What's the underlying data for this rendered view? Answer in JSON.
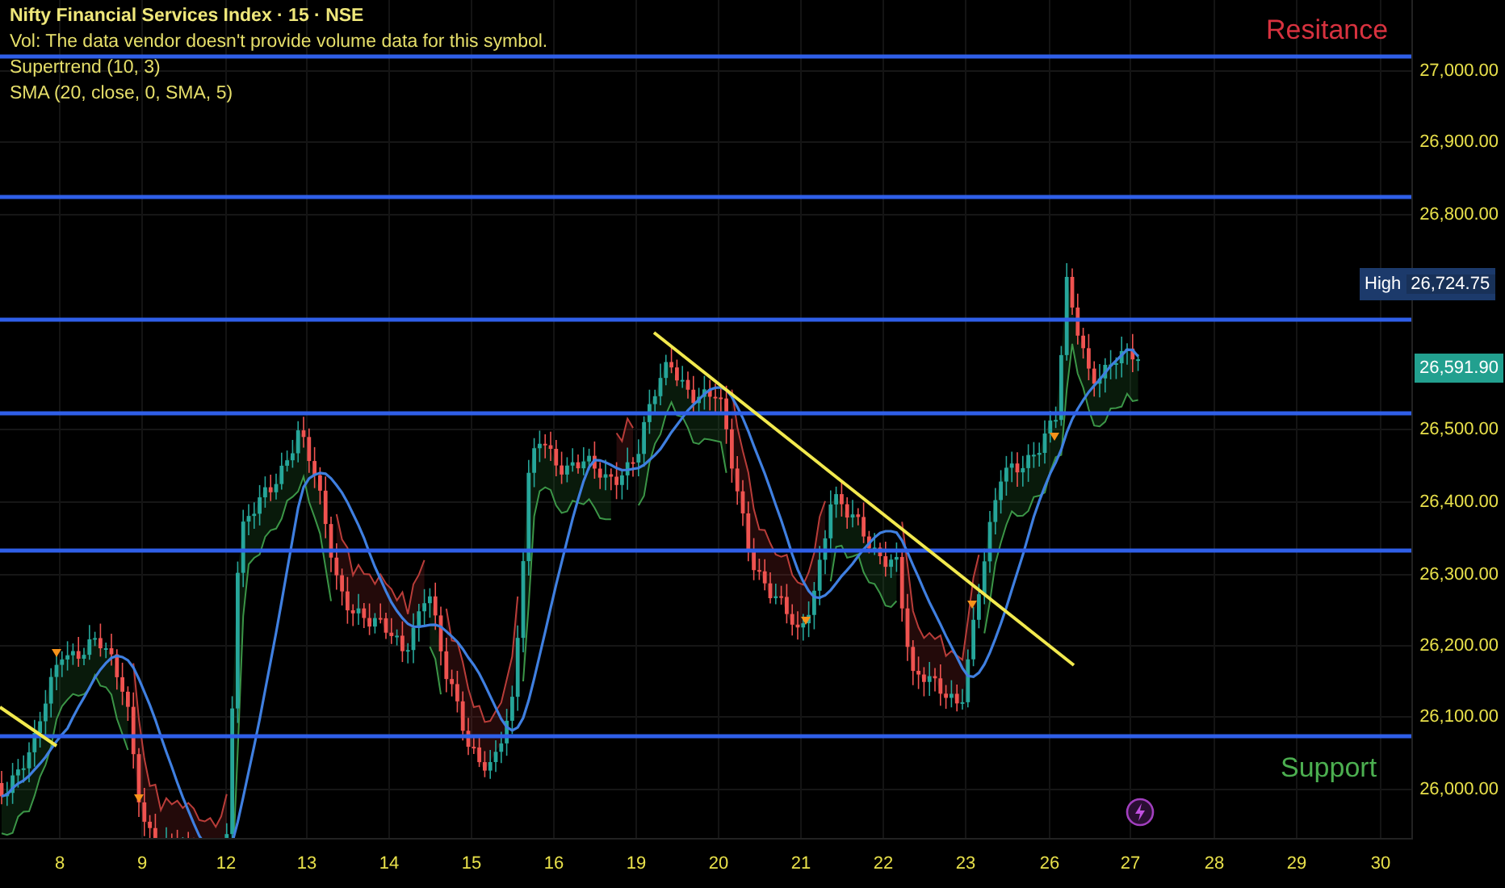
{
  "legend": {
    "title": "Nifty Financial Services Index · 15 · NSE",
    "lines": [
      "Vol: The data vendor doesn't provide volume data for this symbol.",
      "Supertrend (10, 3)",
      "SMA (20, close, 0, SMA, 5)"
    ]
  },
  "annotations": [
    {
      "text": "Resitance",
      "kind": "resistance"
    },
    {
      "text": "Support",
      "kind": "support"
    }
  ],
  "price_axis": {
    "ticks": [
      "27,000.00",
      "26,900.00",
      "26,800.00",
      "26,500.00",
      "26,400.00",
      "26,300.00",
      "26,200.00",
      "26,100.00",
      "26,000.00"
    ],
    "high_label": {
      "label": "High",
      "value": "26,724.75"
    },
    "last_price": "26,591.90"
  },
  "time_axis": {
    "labels": [
      "8",
      "9",
      "12",
      "13",
      "14",
      "15",
      "16",
      "19",
      "20",
      "21",
      "22",
      "23",
      "26",
      "27",
      "28",
      "29",
      "30"
    ]
  }
}
